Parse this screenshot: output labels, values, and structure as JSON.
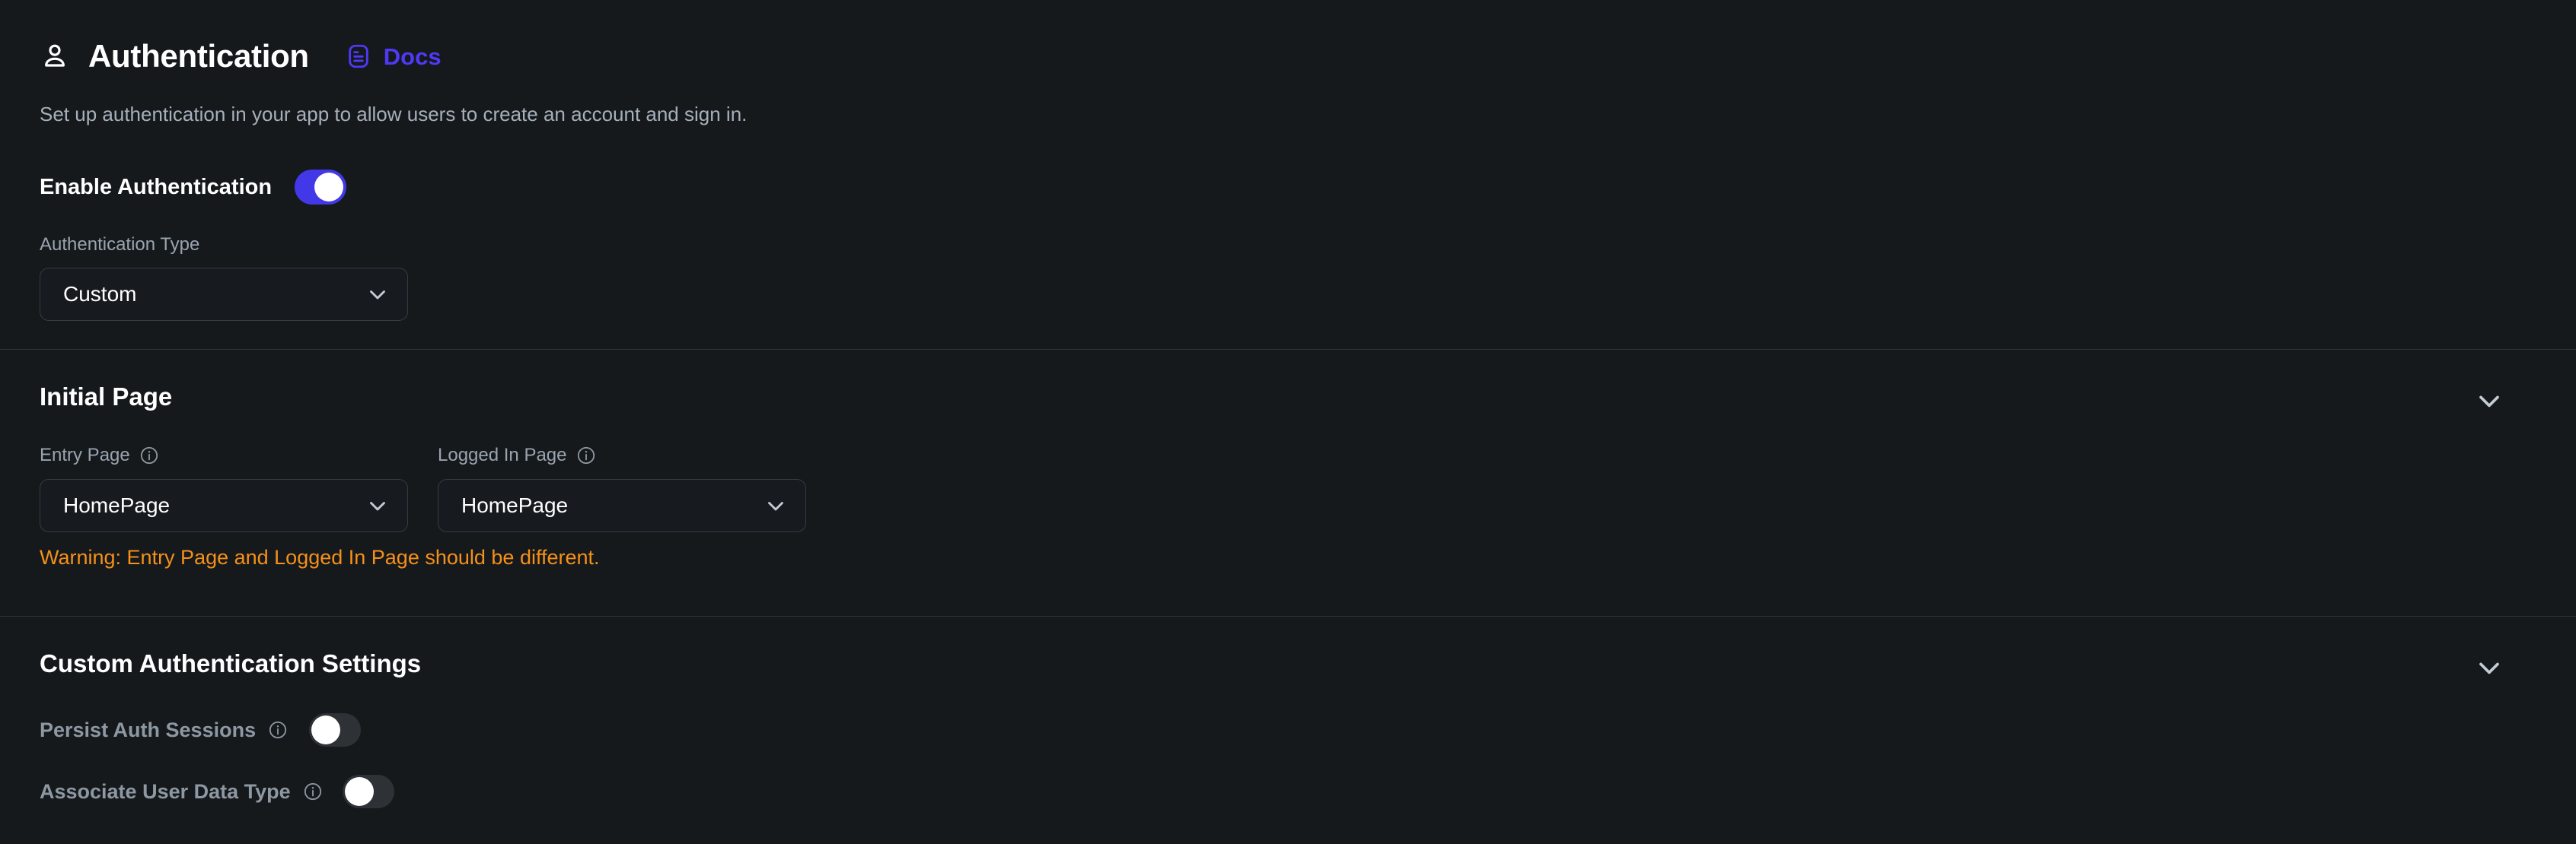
{
  "header": {
    "icon": "person-icon",
    "title": "Authentication",
    "docs_icon": "document-icon",
    "docs_label": "Docs",
    "subtitle": "Set up authentication in your app to allow users to create an account and sign in."
  },
  "enable_authentication": {
    "label": "Enable Authentication",
    "toggle_state": "on"
  },
  "authentication_type": {
    "label": "Authentication Type",
    "value": "Custom",
    "chevron_icon": "chevron-down-icon"
  },
  "initial_page": {
    "heading": "Initial Page",
    "collapse_icon": "chevron-down-icon",
    "entry_page": {
      "label": "Entry Page",
      "info_icon": "info-icon",
      "value": "HomePage",
      "chevron_icon": "chevron-down-icon"
    },
    "logged_in_page": {
      "label": "Logged In Page",
      "info_icon": "info-icon",
      "value": "HomePage",
      "chevron_icon": "chevron-down-icon"
    },
    "warning": "Warning: Entry Page and Logged In Page should be different."
  },
  "custom_authentication_settings": {
    "heading": "Custom Authentication Settings",
    "collapse_icon": "chevron-down-icon",
    "rows": [
      {
        "label": "Persist Auth Sessions",
        "info_icon": "info-icon",
        "toggle_state": "off"
      },
      {
        "label": "Associate User Data Type",
        "info_icon": "info-icon",
        "toggle_state": "off"
      }
    ]
  },
  "colors": {
    "background": "#15191c",
    "accent": "#4f39f6",
    "toggle_on": "#4338e8",
    "toggle_off": "#2e3135",
    "warning": "#f59018",
    "divider": "#2c353d",
    "muted_text": "#9aa4af"
  }
}
